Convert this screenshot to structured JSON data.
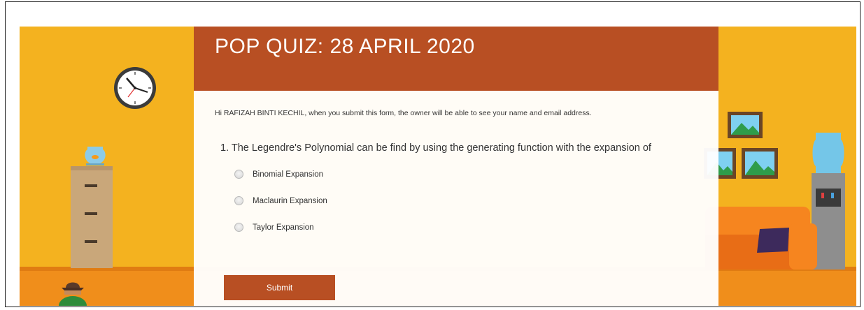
{
  "form": {
    "title": "POP QUIZ: 28 APRIL 2020",
    "notice": "Hi RAFIZAH BINTI KECHIL, when you submit this form, the owner will be able to see your name and email address.",
    "question": {
      "number": "1.",
      "text": "The Legendre's Polynomial can be find by using the generating function with the expansion of",
      "options": [
        {
          "label": "Binomial Expansion",
          "selected": false
        },
        {
          "label": "Maclaurin Expansion",
          "selected": false
        },
        {
          "label": "Taylor Expansion",
          "selected": false
        }
      ]
    },
    "submit_label": "Submit"
  },
  "theme": {
    "header_color": "#b84f23",
    "background_color": "#f4b21f",
    "floor_color": "#f08e1b"
  },
  "decor": {
    "left": [
      "clock-icon",
      "fishbowl-icon",
      "filing-cabinet-icon",
      "hat-person-icon"
    ],
    "right": [
      "picture-frame-icon",
      "water-cooler-icon",
      "sofa-icon"
    ]
  }
}
